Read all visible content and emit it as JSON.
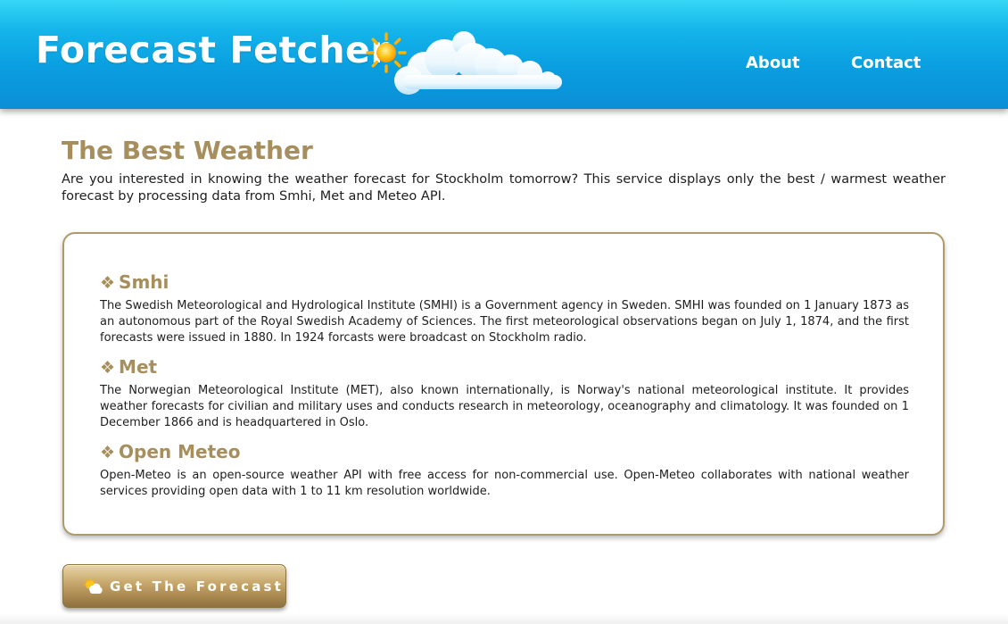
{
  "header": {
    "title": "Forecast Fetcher",
    "sun_icon": "sun-icon",
    "cloud_icon": "cloud-icon",
    "nav": [
      {
        "label": "About"
      },
      {
        "label": "Contact"
      }
    ],
    "colors": {
      "bar_top": "#36d7f5",
      "bar_bottom": "#0b8ed6",
      "text": "#ffffff"
    }
  },
  "main": {
    "title": "The Best Weather",
    "intro": "Are you interested in knowing the weather forecast for Stockholm tomorrow? This service displays only the best / warmest weather forecast by processing data from Smhi, Met and Meteo API.",
    "accent_color": "#a68f5d",
    "sections": [
      {
        "bullet": "❖",
        "heading": "Smhi",
        "body": "The Swedish Meteorological and Hydrological Institute (SMHI) is a Government agency in Sweden. SMHI was founded on 1 January 1873 as an autonomous part of the Royal Swedish Academy of Sciences. The first meteorological observations began on July 1, 1874, and the first forecasts were issued in 1880. In 1924 forcasts were broadcast on Stockholm radio."
      },
      {
        "bullet": "❖",
        "heading": "Met",
        "body": "The Norwegian Meteorological Institute (MET), also known internationally, is Norway's national meteorological institute. It provides weather forecasts for civilian and military uses and conducts research in meteorology, oceanography and climatology. It was founded on 1 December 1866 and is headquartered in Oslo."
      },
      {
        "bullet": "❖",
        "heading": "Open Meteo",
        "body": "Open-Meteo is an open-source weather API with free access for non-commercial use. Open-Meteo collaborates with national weather services providing open data with 1 to 11 km resolution worldwide."
      }
    ]
  },
  "cta": {
    "label": "Get The Forecast",
    "icon": "sun-behind-cloud-icon"
  }
}
